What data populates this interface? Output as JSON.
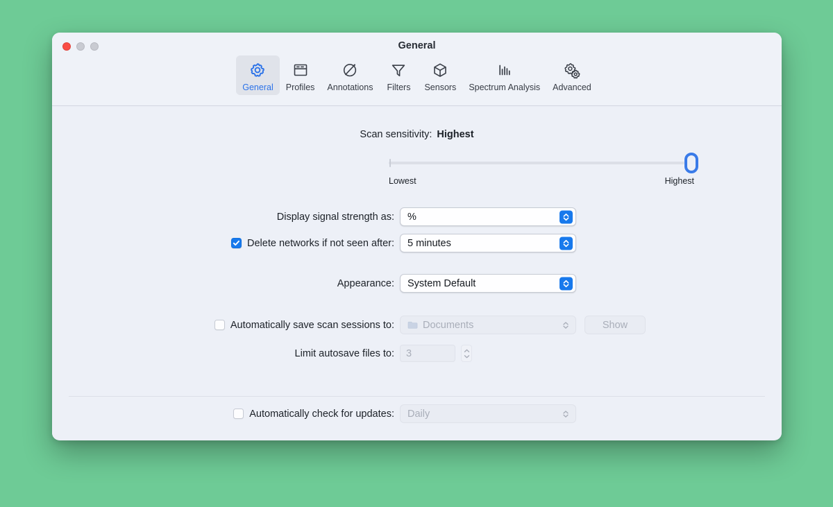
{
  "desktop": {
    "background_color": "#6ECB96"
  },
  "window": {
    "title": "General",
    "traffic_lights": {
      "close": "close",
      "minimize": "minimize",
      "zoom": "zoom"
    }
  },
  "toolbar": {
    "items": [
      {
        "label": "General",
        "icon": "gear-icon",
        "selected": true
      },
      {
        "label": "Profiles",
        "icon": "window-panel-icon",
        "selected": false
      },
      {
        "label": "Annotations",
        "icon": "satellite-dish-icon",
        "selected": false
      },
      {
        "label": "Filters",
        "icon": "funnel-icon",
        "selected": false
      },
      {
        "label": "Sensors",
        "icon": "cube-icon",
        "selected": false
      },
      {
        "label": "Spectrum Analysis",
        "icon": "bar-chart-icon",
        "selected": false
      },
      {
        "label": "Advanced",
        "icon": "double-gear-icon",
        "selected": false
      }
    ]
  },
  "general": {
    "sensitivity": {
      "label": "Scan sensitivity:",
      "value": "Highest",
      "min_label": "Lowest",
      "max_label": "Highest",
      "position_percent": 100
    },
    "signal_strength": {
      "label": "Display signal strength as:",
      "value": "%"
    },
    "delete_networks": {
      "label": "Delete networks if not seen after:",
      "checked": true,
      "value": "5 minutes"
    },
    "appearance": {
      "label": "Appearance:",
      "value": "System Default"
    },
    "autosave_sessions": {
      "label": "Automatically save scan sessions to:",
      "checked": false,
      "value": "Documents",
      "folder_icon": "folder-icon",
      "show_button": "Show"
    },
    "limit_autosave": {
      "label": "Limit autosave files to:",
      "value": "3"
    },
    "auto_updates": {
      "label": "Automatically check for updates:",
      "checked": false,
      "value": "Daily"
    }
  },
  "colors": {
    "accent_blue": "#1879EC",
    "slider_blue": "#3A7BE8",
    "window_bg": "#EDF0F7",
    "close_red": "#FA4E45"
  }
}
